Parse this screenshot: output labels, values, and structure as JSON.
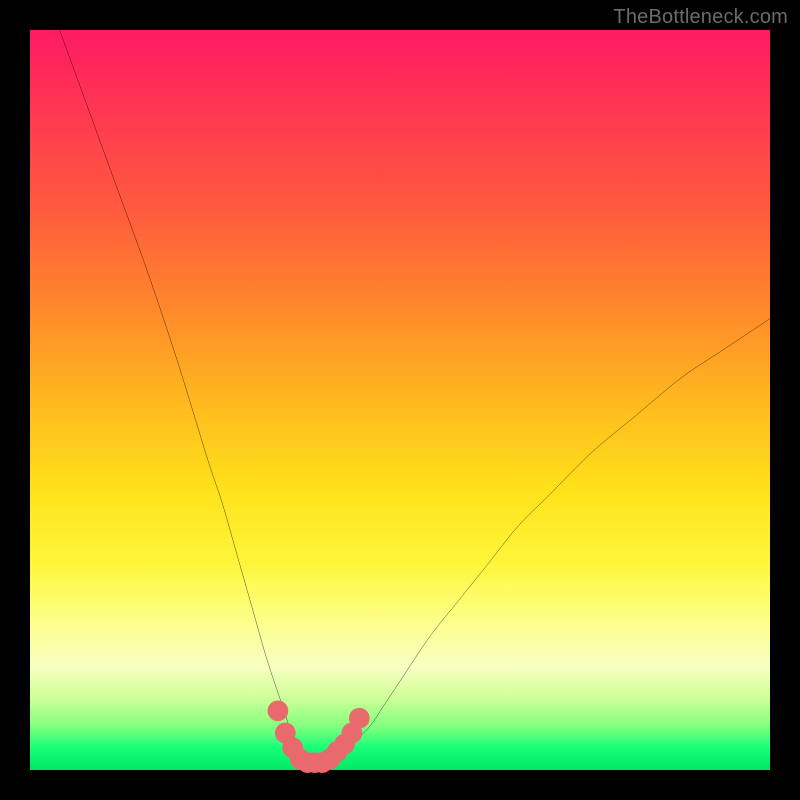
{
  "watermark": "TheBottleneck.com",
  "colors": {
    "background": "#000000",
    "curve": "#000000",
    "marker_fill": "#e96a6d",
    "gradient_stops": [
      "#ff1a63",
      "#ff2f55",
      "#ff5a3e",
      "#ff8a2a",
      "#ffb81f",
      "#ffe11a",
      "#fff63a",
      "#fcff8a",
      "#f7ffc2",
      "#d2ff9a",
      "#86ff7e",
      "#18ff7a",
      "#00e765"
    ]
  },
  "chart_data": {
    "type": "line",
    "title": "",
    "xlabel": "",
    "ylabel": "",
    "xlim": [
      0,
      100
    ],
    "ylim": [
      0,
      100
    ],
    "grid": false,
    "legend": false,
    "series": [
      {
        "name": "bottleneck-curve",
        "x": [
          4,
          8,
          12,
          16,
          20,
          24,
          26,
          28,
          30,
          32,
          34,
          35,
          36,
          37,
          38,
          39,
          40,
          42,
          44,
          46,
          48,
          50,
          54,
          58,
          62,
          66,
          70,
          76,
          82,
          88,
          94,
          100
        ],
        "y": [
          100,
          89,
          78,
          67,
          55,
          42,
          36,
          29,
          22,
          15,
          9,
          6,
          4,
          2,
          1,
          1,
          1,
          2,
          4,
          6,
          9,
          12,
          18,
          23,
          28,
          33,
          37,
          43,
          48,
          53,
          57,
          61
        ]
      }
    ],
    "markers": {
      "name": "trough-markers",
      "x": [
        33.5,
        34.5,
        35.5,
        36.5,
        37.5,
        38.5,
        39.5,
        40.5,
        41.5,
        42.5,
        43.5,
        44.5
      ],
      "y": [
        8,
        5,
        3,
        1.5,
        1,
        1,
        1,
        1.5,
        2.5,
        3.5,
        5,
        7
      ],
      "r": 1.4
    }
  }
}
